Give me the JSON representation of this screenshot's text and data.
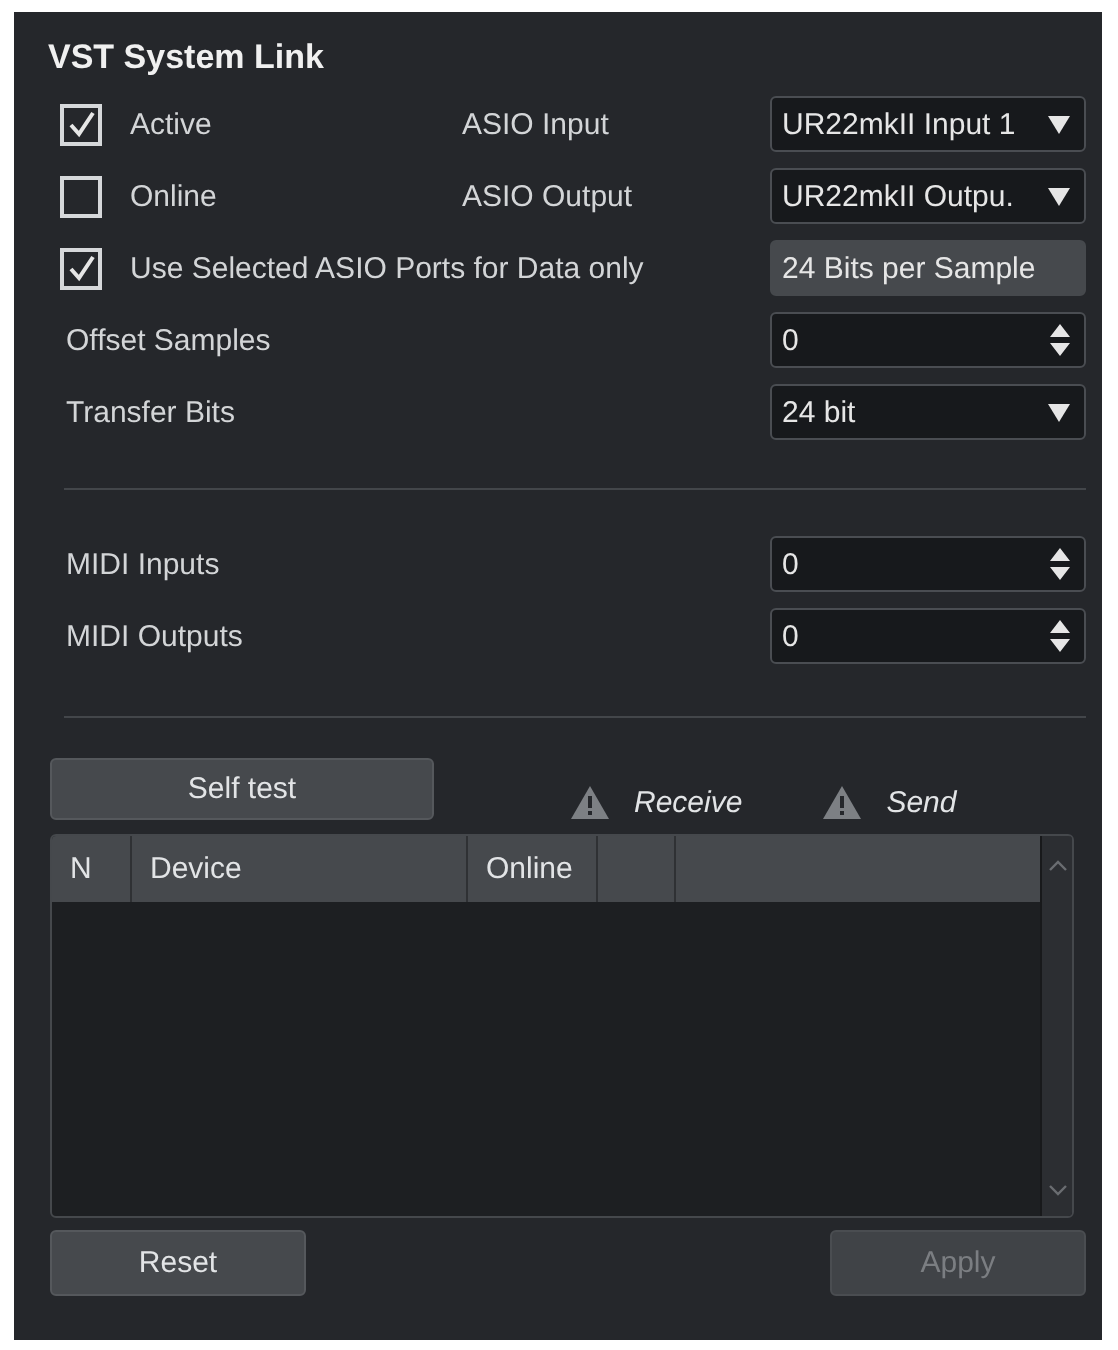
{
  "title": "VST System Link",
  "settings": [
    {
      "kind": "checkbox",
      "label": "Active",
      "checked": true,
      "port_label": "ASIO Input",
      "control": {
        "kind": "select",
        "value": "UR22mkII Input 1"
      }
    },
    {
      "kind": "checkbox",
      "label": "Online",
      "checked": false,
      "port_label": "ASIO Output",
      "control": {
        "kind": "select",
        "value": "UR22mkII Outpu."
      }
    },
    {
      "kind": "checkbox",
      "label": "Use Selected ASIO Ports for Data only",
      "checked": true,
      "control": {
        "kind": "readonly",
        "value": "24 Bits per Sample"
      }
    },
    {
      "kind": "label",
      "label": "Offset Samples",
      "control": {
        "kind": "spin",
        "value": "0"
      }
    },
    {
      "kind": "label",
      "label": "Transfer Bits",
      "control": {
        "kind": "select",
        "value": "24 bit"
      }
    }
  ],
  "midi": [
    {
      "kind": "label",
      "label": "MIDI Inputs",
      "control": {
        "kind": "spin",
        "value": "0"
      }
    },
    {
      "kind": "label",
      "label": "MIDI Outputs",
      "control": {
        "kind": "spin",
        "value": "0"
      }
    }
  ],
  "self_test_button": "Self test",
  "indicators": [
    {
      "label": "Receive"
    },
    {
      "label": "Send"
    }
  ],
  "table": {
    "columns": [
      "N",
      "Device",
      "Online"
    ]
  },
  "buttons": [
    {
      "label": "Reset",
      "disabled": false
    },
    {
      "label": "Apply",
      "disabled": true
    }
  ]
}
